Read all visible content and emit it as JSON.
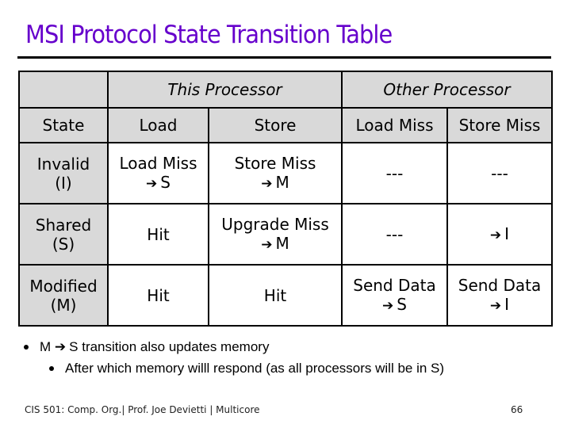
{
  "slide": {
    "title": "MSI Protocol State Transition Table",
    "table": {
      "group_headers": {
        "this_processor": "This Processor",
        "other_processor": "Other Processor"
      },
      "column_headers": [
        "State",
        "Load",
        "Store",
        "Load Miss",
        "Store Miss"
      ],
      "rows": [
        {
          "state": {
            "line1": "Invalid",
            "line2": "(I)"
          },
          "load": {
            "line1": "Load Miss",
            "arrow": "➔",
            "line2": "S"
          },
          "store": {
            "line1": "Store Miss",
            "arrow": "➔",
            "line2": "M"
          },
          "load_miss": {
            "line1": "---"
          },
          "store_miss": {
            "line1": "---"
          }
        },
        {
          "state": {
            "line1": "Shared",
            "line2": "(S)"
          },
          "load": {
            "line1": "Hit"
          },
          "store": {
            "line1": "Upgrade Miss",
            "arrow": "➔",
            "line2": "M"
          },
          "load_miss": {
            "line1": "---"
          },
          "store_miss": {
            "arrow": "➔",
            "line2": "I"
          }
        },
        {
          "state": {
            "line1": "Modified",
            "line2": "(M)"
          },
          "load": {
            "line1": "Hit"
          },
          "store": {
            "line1": "Hit"
          },
          "load_miss": {
            "line1": "Send Data",
            "arrow": "➔",
            "line2": "S"
          },
          "store_miss": {
            "line1": "Send Data",
            "arrow": "➔",
            "line2": "I"
          }
        }
      ]
    },
    "bullets": [
      {
        "pre": "M",
        "arrow": "➔",
        "post": "S transition also updates memory"
      },
      {
        "text": "After which memory willl respond (as all processors will be in S)"
      }
    ],
    "footer": {
      "left": "CIS 501: Comp. Org.|  Prof. Joe Devietti  |  Multicore",
      "page_number": "66"
    },
    "colors": {
      "title": "#6600cc",
      "header_fill": "#d9d9d9"
    }
  }
}
